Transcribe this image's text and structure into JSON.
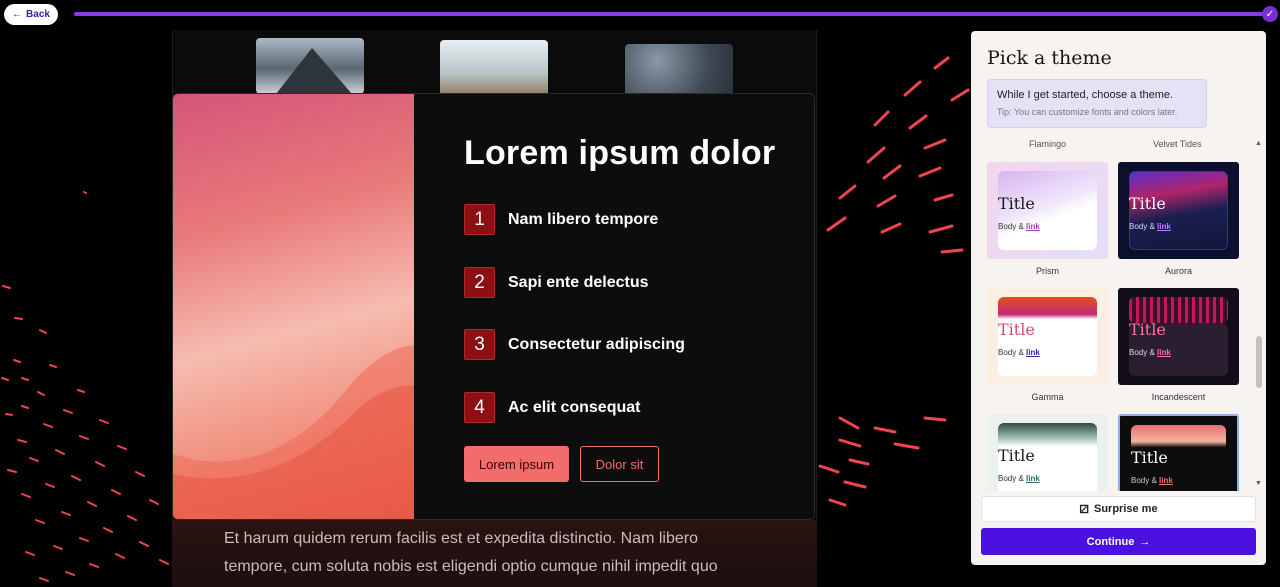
{
  "topbar": {
    "back_label": "Back",
    "back_icon": "arrow-left-icon",
    "progress": 1.0,
    "complete_icon": "check-icon"
  },
  "colors": {
    "accent": "#4a11e0",
    "progress": "#7a2fd6",
    "streak": "#f0454f",
    "number_badge": "#8c0f12",
    "button": "#f26c6c"
  },
  "preview": {
    "title": "Lorem ipsum dolor",
    "items": [
      {
        "num": "1",
        "text": "Nam libero tempore"
      },
      {
        "num": "2",
        "text": "Sapi ente delectus"
      },
      {
        "num": "3",
        "text": "Consectetur adipiscing"
      },
      {
        "num": "4",
        "text": "Ac elit consequat"
      }
    ],
    "primary_button": "Lorem ipsum",
    "secondary_button": "Dolor sit",
    "paragraph": "Et harum quidem rerum facilis est et expedita distinctio. Nam libero tempore, cum soluta nobis est eligendi optio cumque nihil impedit quo"
  },
  "panel": {
    "title": "Pick a theme",
    "tip_line1": "While I get started, choose a theme.",
    "tip_line2": "Tip: You can customize fonts and colors later.",
    "cut_labels": [
      "Flamingo",
      "Velvet Tides"
    ],
    "themes": [
      {
        "name": "Prism",
        "title": "Title",
        "body": "Body & ",
        "link": "link"
      },
      {
        "name": "Aurora",
        "title": "Title",
        "body": "Body & ",
        "link": "link"
      },
      {
        "name": "Gamma",
        "title": "Title",
        "body": "Body & ",
        "link": "link"
      },
      {
        "name": "Incandescent",
        "title": "Title",
        "body": "Body & ",
        "link": "link"
      },
      {
        "name": "",
        "title": "Title",
        "body": "Body & ",
        "link": "link"
      },
      {
        "name": "",
        "title": "Title",
        "body": "Body & ",
        "link": "link"
      }
    ],
    "selected_theme_index": 5,
    "surprise_label": "Surprise me",
    "surprise_icon": "dice-icon",
    "continue_label": "Continue",
    "continue_icon": "arrow-right-icon"
  }
}
